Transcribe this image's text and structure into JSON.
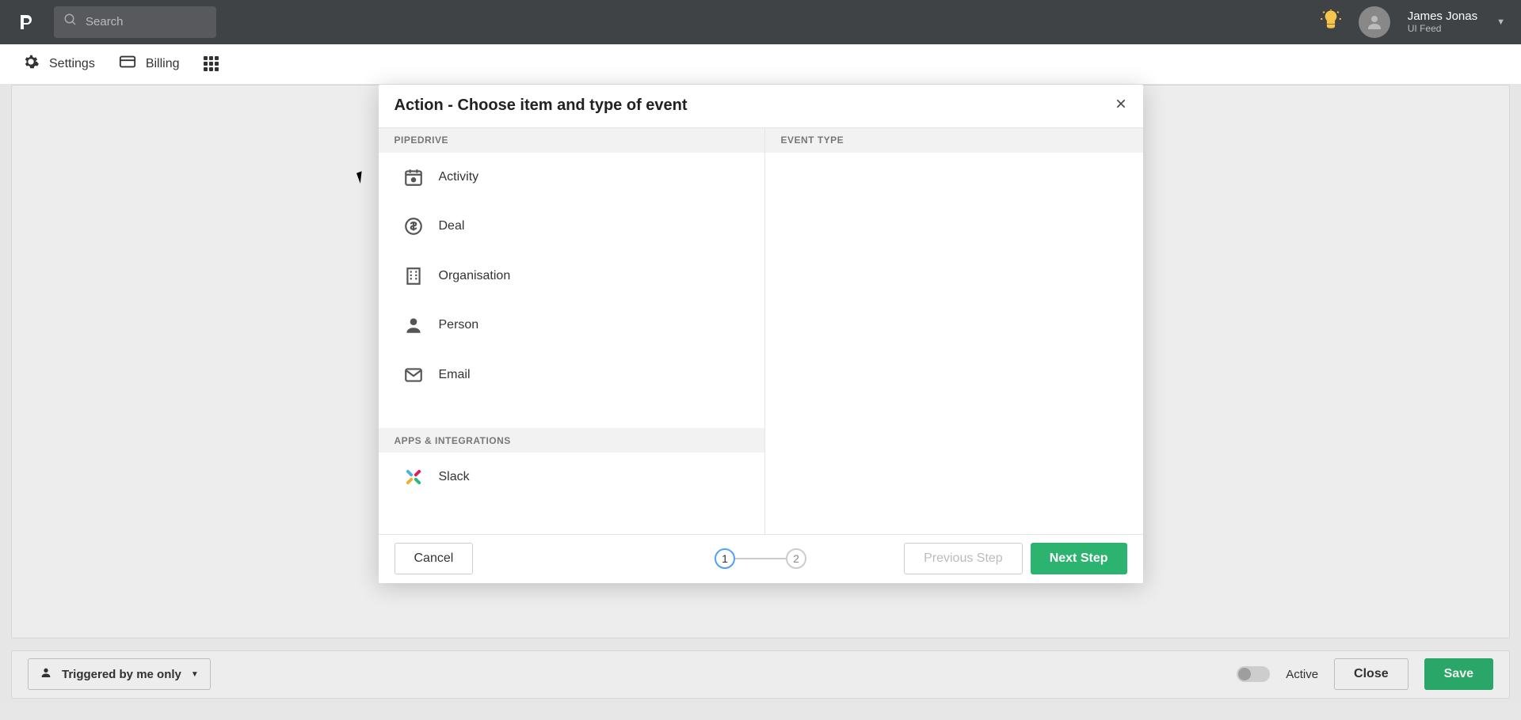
{
  "topbar": {
    "search_placeholder": "Search",
    "user_name": "James Jonas",
    "user_sub": "UI Feed"
  },
  "toolbar": {
    "settings": "Settings",
    "billing": "Billing"
  },
  "canvas_bar": {
    "trigger": "Triggered by me only",
    "active_label": "Active",
    "close": "Close",
    "save": "Save"
  },
  "modal": {
    "title": "Action - Choose item and type of event",
    "left_header": "PIPEDRIVE",
    "right_header": "EVENT TYPE",
    "items": {
      "activity": "Activity",
      "deal": "Deal",
      "organisation": "Organisation",
      "person": "Person",
      "email": "Email"
    },
    "apps_header": "APPS & INTEGRATIONS",
    "apps": {
      "slack": "Slack"
    },
    "cancel": "Cancel",
    "prev": "Previous Step",
    "next": "Next Step",
    "step1": "1",
    "step2": "2"
  }
}
